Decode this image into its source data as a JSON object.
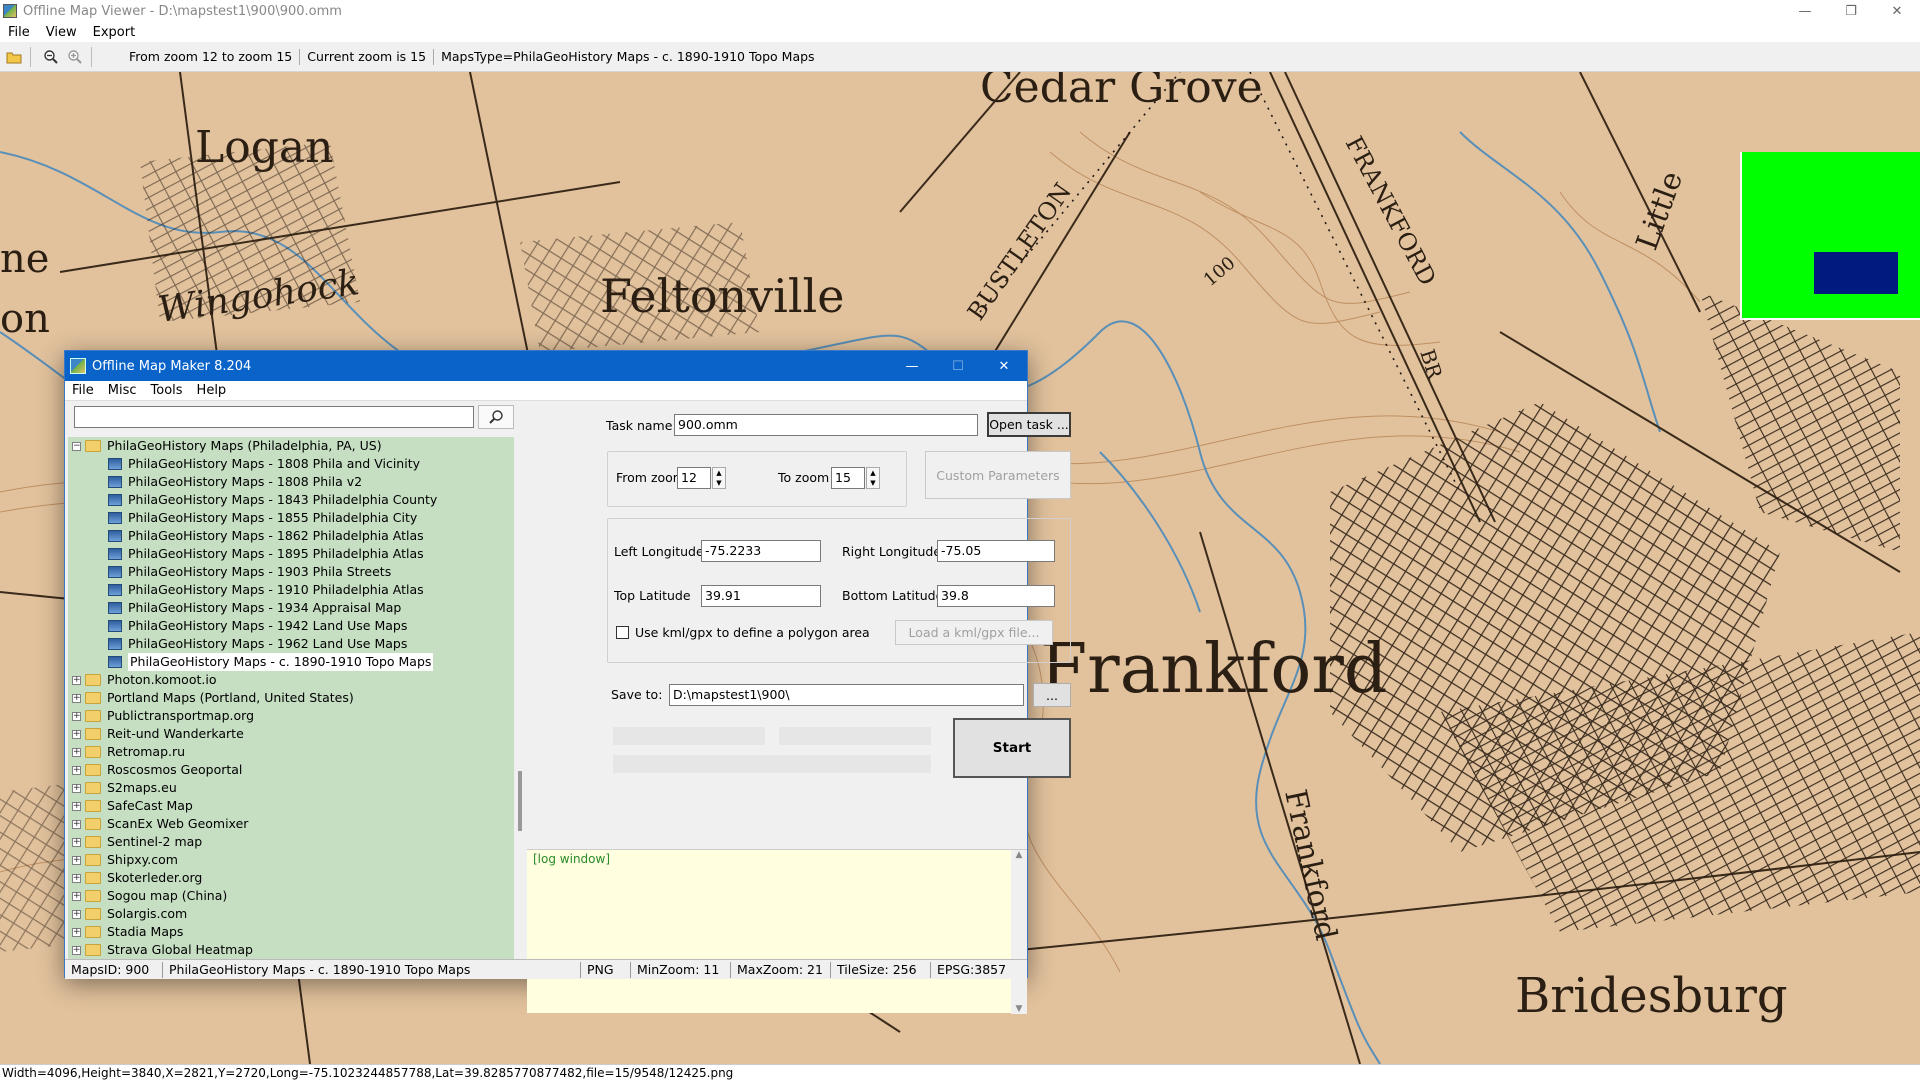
{
  "viewer": {
    "title": "Offline Map Viewer - D:\\mapstest1\\900\\900.omm",
    "menu": [
      "File",
      "View",
      "Export"
    ],
    "toolbar": {
      "zoom_range": "From zoom 12 to zoom 15",
      "current_zoom": "Current zoom is 15",
      "maps_type": "MapsType=PhilaGeoHistory Maps - c. 1890-1910 Topo Maps"
    },
    "status": "Width=4096,Height=3840,X=2821,Y=2720,Long=-75.1023244857788,Lat=39.8285770877482,file=15/9548/12425.png"
  },
  "map": {
    "labels": [
      "Cedar Grove",
      "Logan",
      "Feltonville",
      "BUSTLETON",
      "FRANKFORD",
      "Frankford",
      "Bridesburg",
      "Little",
      "BR",
      "Frankford",
      "Wingohock",
      "ne",
      "on",
      "100"
    ],
    "colors": {
      "paper": "#e2c29d",
      "road": "#3a2a1a",
      "water": "#5a8fb8",
      "contour": "#b07a4a",
      "overview": "#00ff00",
      "overview_viewport": "#001a80"
    }
  },
  "dialog": {
    "title": "Offline Map Maker 8.204",
    "menu": [
      "File",
      "Misc",
      "Tools",
      "Help"
    ],
    "search": {
      "value": "",
      "placeholder": ""
    },
    "tree": [
      {
        "label": "PhilaGeoHistory Maps (Philadelphia, PA, US)",
        "level": 0,
        "expanded": true
      },
      {
        "label": "PhilaGeoHistory Maps - 1808 Phila and Vicinity",
        "level": 1
      },
      {
        "label": "PhilaGeoHistory Maps - 1808 Phila v2",
        "level": 1
      },
      {
        "label": "PhilaGeoHistory Maps - 1843 Philadelphia County",
        "level": 1
      },
      {
        "label": "PhilaGeoHistory Maps - 1855 Philadelphia City",
        "level": 1
      },
      {
        "label": "PhilaGeoHistory Maps - 1862 Philadelphia Atlas",
        "level": 1
      },
      {
        "label": "PhilaGeoHistory Maps - 1895 Philadelphia Atlas",
        "level": 1
      },
      {
        "label": "PhilaGeoHistory Maps - 1903 Phila Streets",
        "level": 1
      },
      {
        "label": "PhilaGeoHistory Maps - 1910 Philadelphia Atlas",
        "level": 1
      },
      {
        "label": "PhilaGeoHistory Maps - 1934 Appraisal Map",
        "level": 1
      },
      {
        "label": "PhilaGeoHistory Maps - 1942 Land Use Maps",
        "level": 1
      },
      {
        "label": "PhilaGeoHistory Maps - 1962 Land Use Maps",
        "level": 1
      },
      {
        "label": "PhilaGeoHistory Maps - c. 1890-1910 Topo Maps",
        "level": 1,
        "selected": true
      },
      {
        "label": "Photon.komoot.io",
        "level": 0
      },
      {
        "label": "Portland Maps (Portland, United States)",
        "level": 0
      },
      {
        "label": "Publictransportmap.org",
        "level": 0
      },
      {
        "label": "Reit-und Wanderkarte",
        "level": 0
      },
      {
        "label": "Retromap.ru",
        "level": 0
      },
      {
        "label": "Roscosmos Geoportal",
        "level": 0
      },
      {
        "label": "S2maps.eu",
        "level": 0
      },
      {
        "label": "SafeCast Map",
        "level": 0
      },
      {
        "label": "ScanEx Web Geomixer",
        "level": 0
      },
      {
        "label": "Sentinel-2 map",
        "level": 0
      },
      {
        "label": "Shipxy.com",
        "level": 0
      },
      {
        "label": "Skoterleder.org",
        "level": 0
      },
      {
        "label": "Sogou map (China)",
        "level": 0
      },
      {
        "label": "Solargis.com",
        "level": 0
      },
      {
        "label": "Stadia Maps",
        "level": 0
      },
      {
        "label": "Strava Global Heatmap",
        "level": 0
      }
    ],
    "form": {
      "task_name_label": "Task name",
      "task_name_value": "900.omm",
      "open_task": "Open task ...",
      "from_zoom_label": "From zoom",
      "from_zoom_value": "12",
      "to_zoom_label": "To zoom",
      "to_zoom_value": "15",
      "custom_params": "Custom Parameters",
      "left_lon_label": "Left Longitude",
      "left_lon_value": "-75.2233",
      "right_lon_label": "Right Longitude",
      "right_lon_value": "-75.05",
      "top_lat_label": "Top Latitude",
      "top_lat_value": "39.91",
      "bottom_lat_label": "Bottom Latitude",
      "bottom_lat_value": "39.8",
      "use_kml_label": "Use kml/gpx to define a polygon area",
      "use_kml_checked": false,
      "load_kml": "Load a kml/gpx file...",
      "save_to_label": "Save to:",
      "save_to_value": "D:\\mapstest1\\900\\",
      "browse": "...",
      "start": "Start"
    },
    "log": "[log window]",
    "status": {
      "maps_id": "MapsID: 900",
      "maps_name": "PhilaGeoHistory Maps - c. 1890-1910 Topo Maps",
      "format": "PNG",
      "min_zoom": "MinZoom: 11",
      "max_zoom": "MaxZoom: 21",
      "tile_size": "TileSize: 256",
      "epsg": "EPSG:3857"
    }
  }
}
